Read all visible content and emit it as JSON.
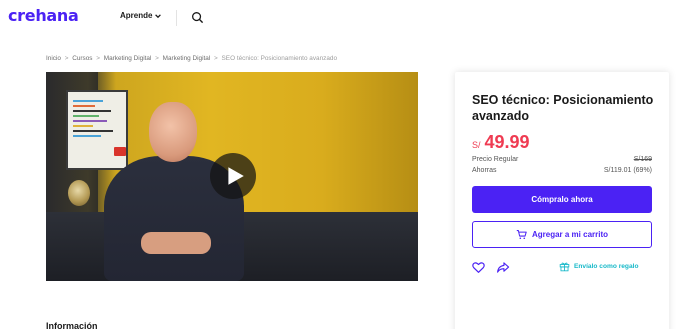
{
  "header": {
    "logo_text": "crehana",
    "nav_learn_label": "Aprende",
    "icons": {
      "dropdown": "chevron-down-icon",
      "search": "search-icon"
    }
  },
  "breadcrumb": {
    "items": [
      "Inicio",
      "Cursos",
      "Marketing Digital",
      "Marketing Digital",
      "SEO técnico: Posicionamiento avanzado"
    ],
    "separator": ">"
  },
  "video": {
    "icon": "play-icon"
  },
  "card": {
    "title": "SEO técnico: Posicionamiento avanzado",
    "currency": "S/",
    "price": "49.99",
    "regular_label": "Precio Regular",
    "regular_value": "S/169",
    "savings_label": "Ahorras",
    "savings_value": "S/119.01 (69%)",
    "buy_label": "Cómpralo ahora",
    "cart_label": "Agregar a mi carrito",
    "gift_label": "Envíalo como regalo",
    "icons": {
      "cart": "cart-icon",
      "heart": "heart-icon",
      "share": "share-icon",
      "gift": "gift-icon"
    }
  },
  "sections": {
    "info_heading": "Información"
  },
  "colors": {
    "brand": "#4b22f4",
    "price": "#ef3b52",
    "gift": "#17b9c9"
  }
}
